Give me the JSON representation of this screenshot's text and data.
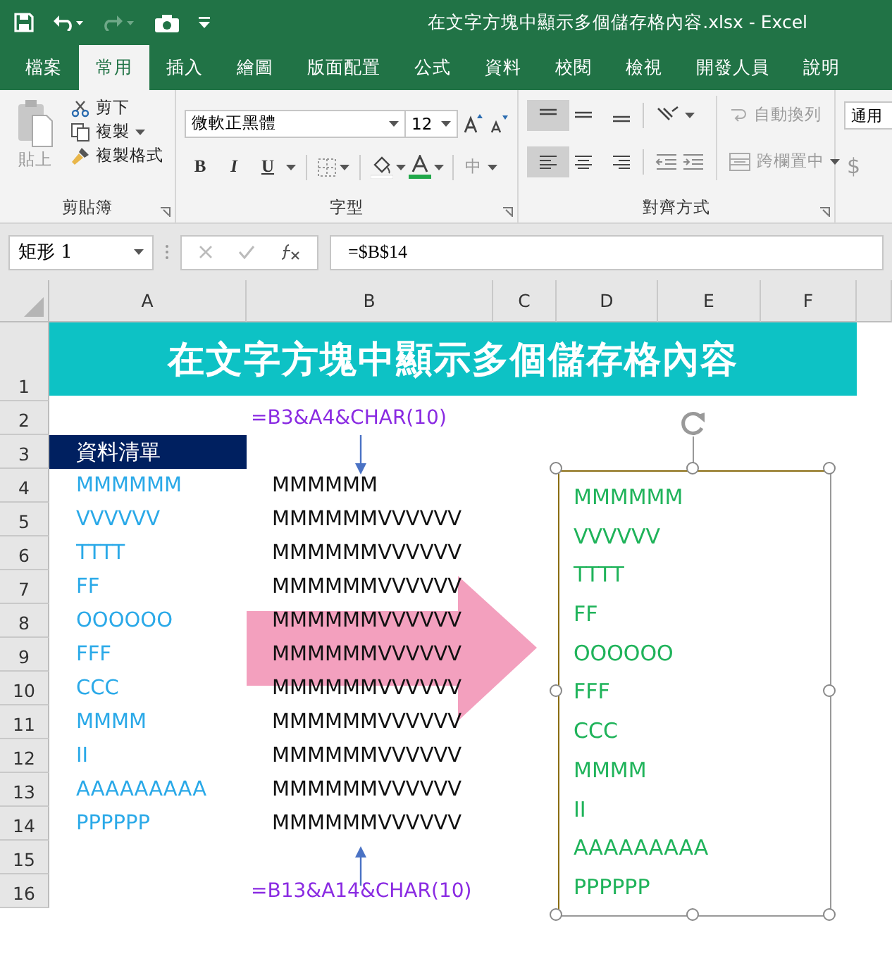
{
  "window": {
    "title": "在文字方塊中顯示多個儲存格內容.xlsx  -  Excel"
  },
  "ribbon_tabs": [
    {
      "label": "檔案",
      "selected": false
    },
    {
      "label": "常用",
      "selected": true
    },
    {
      "label": "插入",
      "selected": false
    },
    {
      "label": "繪圖",
      "selected": false
    },
    {
      "label": "版面配置",
      "selected": false
    },
    {
      "label": "公式",
      "selected": false
    },
    {
      "label": "資料",
      "selected": false
    },
    {
      "label": "校閱",
      "selected": false
    },
    {
      "label": "檢視",
      "selected": false
    },
    {
      "label": "開發人員",
      "selected": false
    },
    {
      "label": "說明",
      "selected": false
    }
  ],
  "clipboard": {
    "paste": "貼上",
    "cut": "剪下",
    "copy": "複製",
    "format_painter": "複製格式",
    "group": "剪貼簿"
  },
  "font": {
    "name": "微軟正黑體",
    "size": "12",
    "bold": "B",
    "italic": "I",
    "underline": "U",
    "phonetic": "中",
    "group": "字型"
  },
  "alignment": {
    "wrap_text": "自動換列",
    "merge_center": "跨欄置中",
    "group": "對齊方式"
  },
  "number": {
    "format": "通用",
    "currency": "$"
  },
  "name_box": {
    "value": "矩形 1"
  },
  "formula_bar": {
    "value": "=$B$14"
  },
  "columns": [
    "A",
    "B",
    "C",
    "D",
    "E",
    "F"
  ],
  "rows": [
    "1",
    "2",
    "3",
    "4",
    "5",
    "6",
    "7",
    "8",
    "9",
    "10",
    "11",
    "12",
    "13",
    "14",
    "15",
    "16"
  ],
  "sheet": {
    "title": "在文字方塊中顯示多個儲存格內容",
    "list_header": "資料清單",
    "formula_top": "=B3&A4&CHAR(10)",
    "formula_bottom": "=B13&A14&CHAR(10)",
    "column_a": [
      "MMMMMM",
      "VVVVVV",
      "TTTT",
      "FF",
      "OOOOOO",
      "FFF",
      "CCC",
      "MMMM",
      "II",
      "AAAAAAAAA",
      "PPPPPP"
    ],
    "column_b": [
      "MMMMMM",
      "MMMMMMVVVVVV",
      "MMMMMMVVVVVV",
      "MMMMMMVVVVVV",
      "MMMMMMVVVVVV",
      "MMMMMMVVVVVV",
      "MMMMMMVVVVVV",
      "MMMMMMVVVVVV",
      "MMMMMMVVVVVV",
      "MMMMMMVVVVVV",
      "MMMMMMVVVVVV"
    ]
  },
  "textbox": {
    "lines": [
      "MMMMMM",
      "VVVVVV",
      "TTTT",
      "FF",
      "OOOOOO",
      "FFF",
      "CCC",
      "MMMM",
      "II",
      "AAAAAAAAA",
      "PPPPPP"
    ]
  }
}
